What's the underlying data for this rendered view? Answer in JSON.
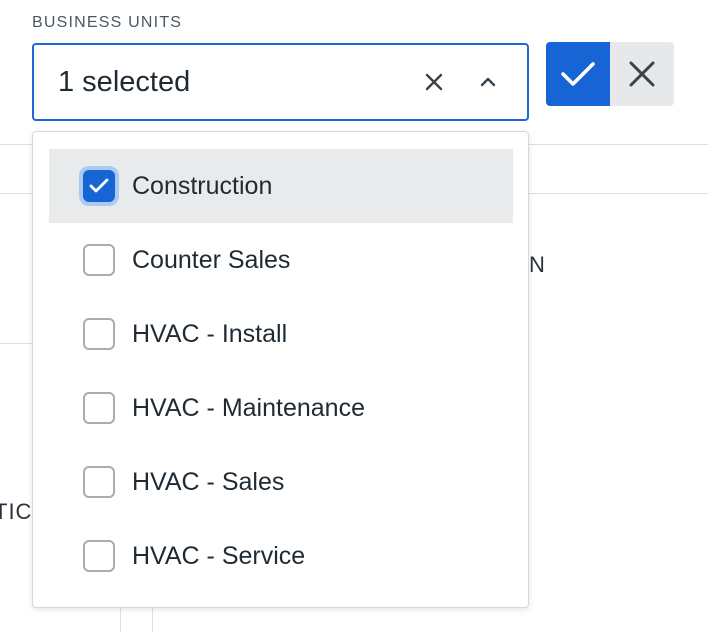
{
  "field": {
    "label": "BUSINESS UNITS",
    "value": "1 selected"
  },
  "colors": {
    "accent": "#1764d4",
    "focus_ring": "#a9cbf3",
    "hover_bg": "#e9eaeb",
    "cancel_bg": "#e7e8e9"
  },
  "icons": {
    "clear": "close-icon",
    "caret": "chevron-up-icon",
    "confirm": "checkmark-icon",
    "cancel": "close-icon"
  },
  "background_fragments": {
    "right_letter": "N",
    "left_letters": "TIC"
  },
  "options": [
    {
      "label": "Construction",
      "checked": true
    },
    {
      "label": "Counter Sales",
      "checked": false
    },
    {
      "label": "HVAC - Install",
      "checked": false
    },
    {
      "label": "HVAC - Maintenance",
      "checked": false
    },
    {
      "label": "HVAC - Sales",
      "checked": false
    },
    {
      "label": "HVAC - Service",
      "checked": false
    }
  ]
}
